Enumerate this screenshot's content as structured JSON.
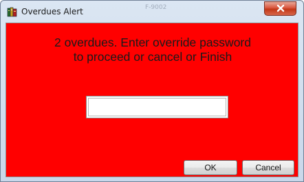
{
  "window": {
    "title": "Overdues Alert",
    "ghost_title": "F-9002",
    "close_glyph": "x"
  },
  "dialog": {
    "message_line1": "2 overdues. Enter override password",
    "message_line2": "to proceed or cancel or Finish",
    "password_value": "",
    "ok_label": "OK",
    "cancel_label": "Cancel",
    "background_color": "#ff0000"
  },
  "icons": {
    "app": "books-icon",
    "close": "close-icon"
  }
}
